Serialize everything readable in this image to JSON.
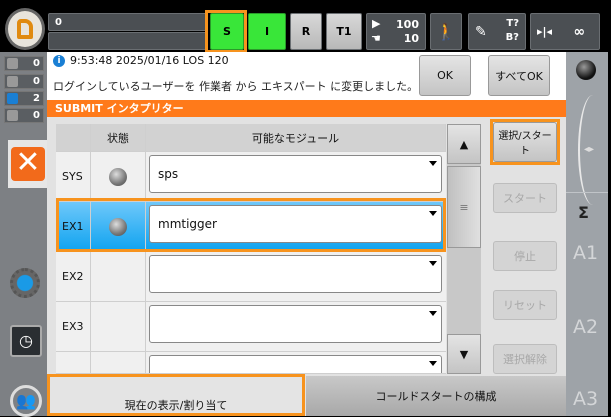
{
  "topbar": {
    "progress_value": "0",
    "submit_label": "S",
    "interpreter_label": "I",
    "robot_label": "R",
    "mode_label": "T1",
    "override_program": "100",
    "override_jog": "10",
    "tool_label": "T?",
    "base_label": "B?",
    "step_label": "∞"
  },
  "counters": [
    {
      "icon": "error-icon",
      "value": "0"
    },
    {
      "icon": "warning-icon",
      "value": "0"
    },
    {
      "icon": "info-icon",
      "value": "2"
    },
    {
      "icon": "wait-icon",
      "value": "0"
    }
  ],
  "message": {
    "header": "9:53:48 2025/01/16 LOS 120",
    "text": "ログインしているユーザーを 作業者 から エキスパート に変更しました。",
    "ok": "OK",
    "ok_all": "すべてOK"
  },
  "panel": {
    "title": "SUBMIT インタプリター",
    "columns": [
      "",
      "状態",
      "可能なモジュール"
    ],
    "rows": [
      {
        "name": "SYS",
        "status": true,
        "module": "sps"
      },
      {
        "name": "EX1",
        "status": true,
        "module": "mmtigger",
        "selected": true
      },
      {
        "name": "EX2",
        "status": false,
        "module": ""
      },
      {
        "name": "EX3",
        "status": false,
        "module": ""
      },
      {
        "name": "",
        "status": false,
        "module": ""
      }
    ],
    "buttons": {
      "select_start": "選択/スタート",
      "start": "スタート",
      "stop": "停止",
      "reset": "リセット",
      "deselect": "選択解除"
    },
    "tabs": [
      "現在の表示/割り当て",
      "コールドスタートの構成"
    ]
  },
  "right": {
    "axes": [
      "A1",
      "A2",
      "A3"
    ]
  },
  "colors": {
    "accent": "#f7931e",
    "header": "#ff7a1a",
    "selected": "#1aa9f2",
    "green": "#39e639"
  }
}
